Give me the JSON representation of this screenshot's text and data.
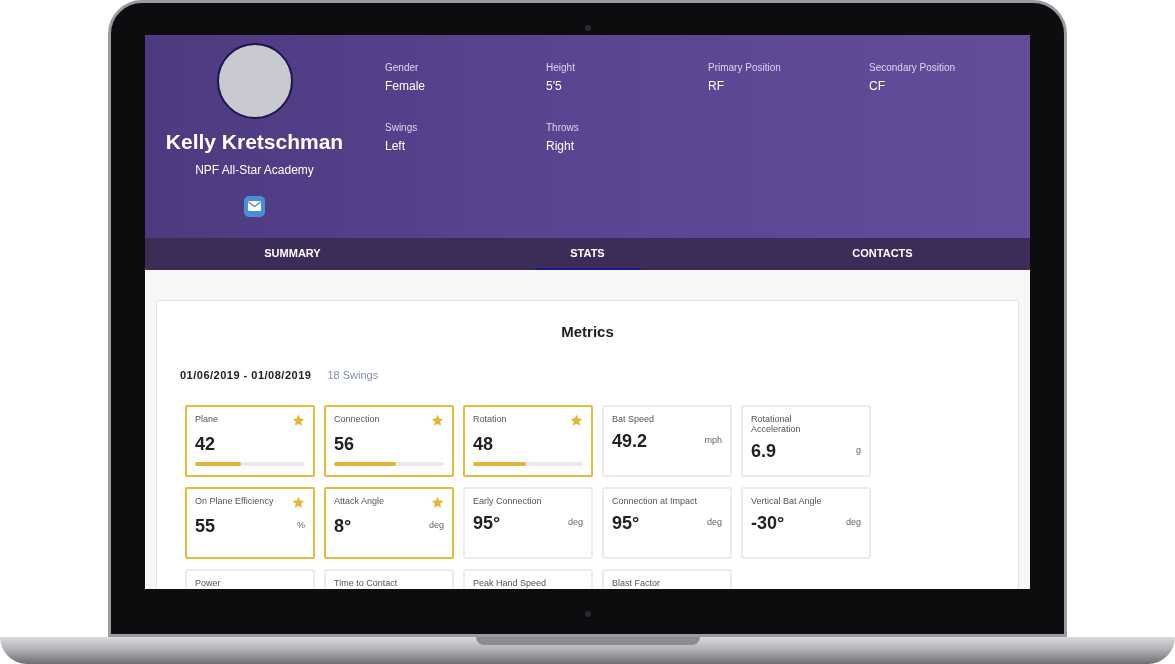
{
  "profile": {
    "name": "Kelly Kretschman",
    "team": "NPF All-Star Academy"
  },
  "details": [
    {
      "label": "Gender",
      "value": "Female"
    },
    {
      "label": "Height",
      "value": "5'5"
    },
    {
      "label": "Primary Position",
      "value": "RF"
    },
    {
      "label": "Secondary Position",
      "value": "CF"
    },
    {
      "label": "Swings",
      "value": "Left"
    },
    {
      "label": "Throws",
      "value": "Right"
    }
  ],
  "tabs": [
    {
      "label": "SUMMARY",
      "selected": false
    },
    {
      "label": "STATS",
      "selected": true
    },
    {
      "label": "CONTACTS",
      "selected": false
    }
  ],
  "metrics_panel": {
    "title": "Metrics",
    "date_range": "01/06/2019 - 01/08/2019",
    "swings": "18 Swings",
    "cards": [
      {
        "label": "Plane",
        "value": "42",
        "featured": true,
        "level": 0.42
      },
      {
        "label": "Connection",
        "value": "56",
        "featured": true,
        "level": 0.56
      },
      {
        "label": "Rotation",
        "value": "48",
        "featured": true,
        "level": 0.48
      },
      {
        "label": "Bat Speed",
        "value": "49.2",
        "unit": "mph",
        "featured": false
      },
      {
        "label": "Rotational Acceleration",
        "value": "6.9",
        "unit": "g",
        "featured": false
      },
      {
        "label": "On Plane Efficiency",
        "value": "55",
        "unit": "%",
        "featured": true
      },
      {
        "label": "Attack Angle",
        "value": "8°",
        "unit": "deg",
        "featured": true
      },
      {
        "label": "Early Connection",
        "value": "95°",
        "unit": "deg",
        "featured": false
      },
      {
        "label": "Connection at Impact",
        "value": "95°",
        "unit": "deg",
        "featured": false
      },
      {
        "label": "Vertical Bat Angle",
        "value": "-30°",
        "unit": "deg",
        "featured": false
      },
      {
        "label": "Power",
        "featured": false
      },
      {
        "label": "Time to Contact",
        "featured": false
      },
      {
        "label": "Peak Hand Speed",
        "featured": false
      },
      {
        "label": "Blast Factor",
        "featured": false
      }
    ]
  }
}
